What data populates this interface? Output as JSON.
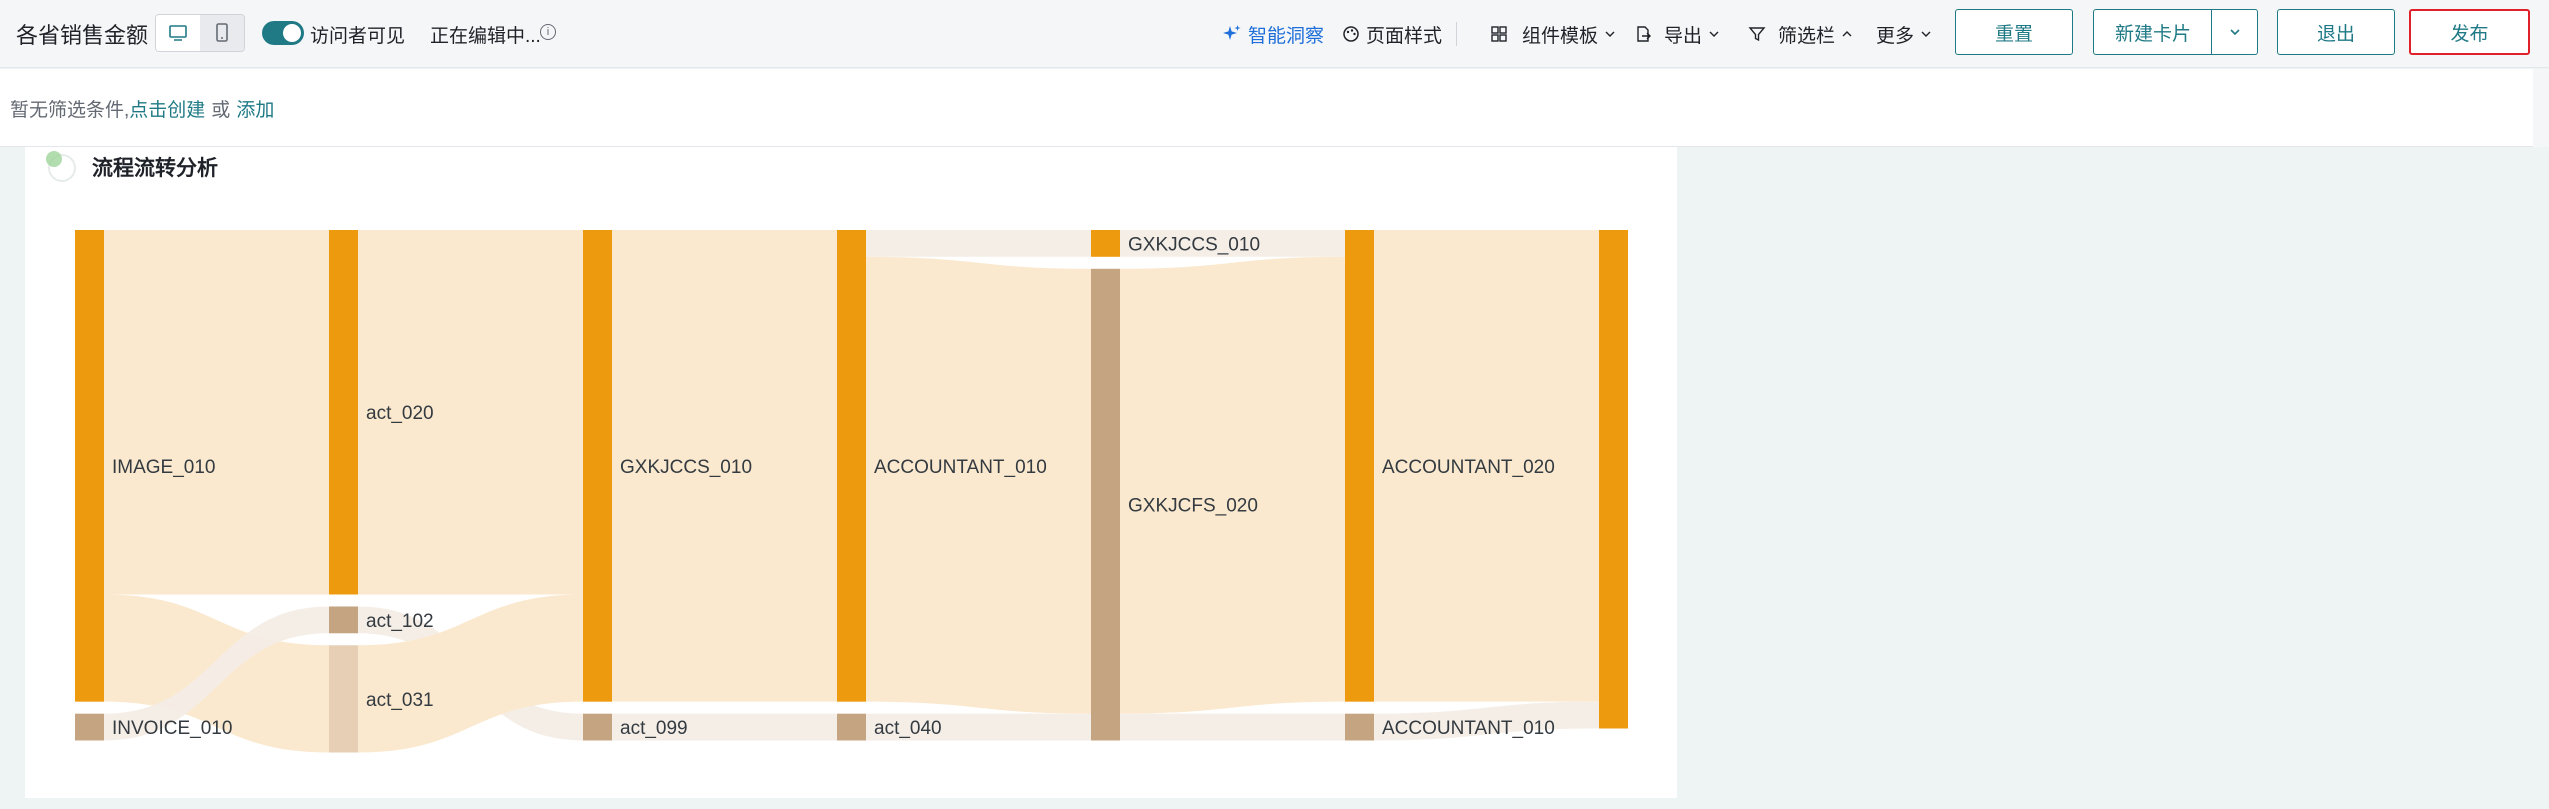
{
  "topbar": {
    "title": "各省销售金额",
    "visitor_visible": "访问者可见",
    "editing_status": "正在编辑中...",
    "smart_insight": "智能洞察",
    "page_style": "页面样式",
    "component_template": "组件模板",
    "export": "导出",
    "filter_bar": "筛选栏",
    "more": "更多",
    "reset": "重置",
    "new_card": "新建卡片",
    "exit": "退出",
    "publish": "发布",
    "accent_color": "#1f7a86",
    "link_color": "#1e6fd9"
  },
  "filterbar": {
    "prefix": "暂无筛选条件,",
    "create_link": "点击创建",
    "or": "或",
    "add_link": "添加"
  },
  "card": {
    "title": "流程流转分析"
  },
  "chart_data": {
    "type": "sankey",
    "colors": {
      "primary_node": "#ee9a0e",
      "secondary_node": "#c4a481",
      "primary_flow": "#fbe9cf",
      "secondary_flow": "#f4ede6"
    },
    "nodes": [
      {
        "name": "IMAGE_010",
        "column": 0
      },
      {
        "name": "INVOICE_010",
        "column": 0
      },
      {
        "name": "act_020",
        "column": 1
      },
      {
        "name": "act_102",
        "column": 1
      },
      {
        "name": "act_031",
        "column": 1
      },
      {
        "name": "GXKJCCS_010",
        "column": 2
      },
      {
        "name": "act_099",
        "column": 2
      },
      {
        "name": "ACCOUNTANT_010",
        "column": 3
      },
      {
        "name": "act_040",
        "column": 3
      },
      {
        "name": "GXKJCCS_010",
        "column": 4
      },
      {
        "name": "GXKJCFS_020",
        "column": 4
      },
      {
        "name": "ACCOUNTANT_020",
        "column": 5
      },
      {
        "name": "ACCOUNTANT_010",
        "column": 5
      },
      {
        "name": "",
        "column": 6
      }
    ],
    "links": [
      {
        "source": 0,
        "target": 2,
        "value": 680
      },
      {
        "source": 0,
        "target": 4,
        "value": 200
      },
      {
        "source": 1,
        "target": 3,
        "value": 50
      },
      {
        "source": 2,
        "target": 5,
        "value": 680
      },
      {
        "source": 3,
        "target": 6,
        "value": 50
      },
      {
        "source": 4,
        "target": 5,
        "value": 200
      },
      {
        "source": 5,
        "target": 7,
        "value": 880
      },
      {
        "source": 6,
        "target": 8,
        "value": 50
      },
      {
        "source": 7,
        "target": 9,
        "value": 50
      },
      {
        "source": 7,
        "target": 10,
        "value": 830
      },
      {
        "source": 8,
        "target": 10,
        "value": 50
      },
      {
        "source": 9,
        "target": 11,
        "value": 50
      },
      {
        "source": 10,
        "target": 11,
        "value": 830
      },
      {
        "source": 10,
        "target": 12,
        "value": 50
      },
      {
        "source": 11,
        "target": 13,
        "value": 880
      },
      {
        "source": 12,
        "target": 13,
        "value": 50
      }
    ]
  }
}
